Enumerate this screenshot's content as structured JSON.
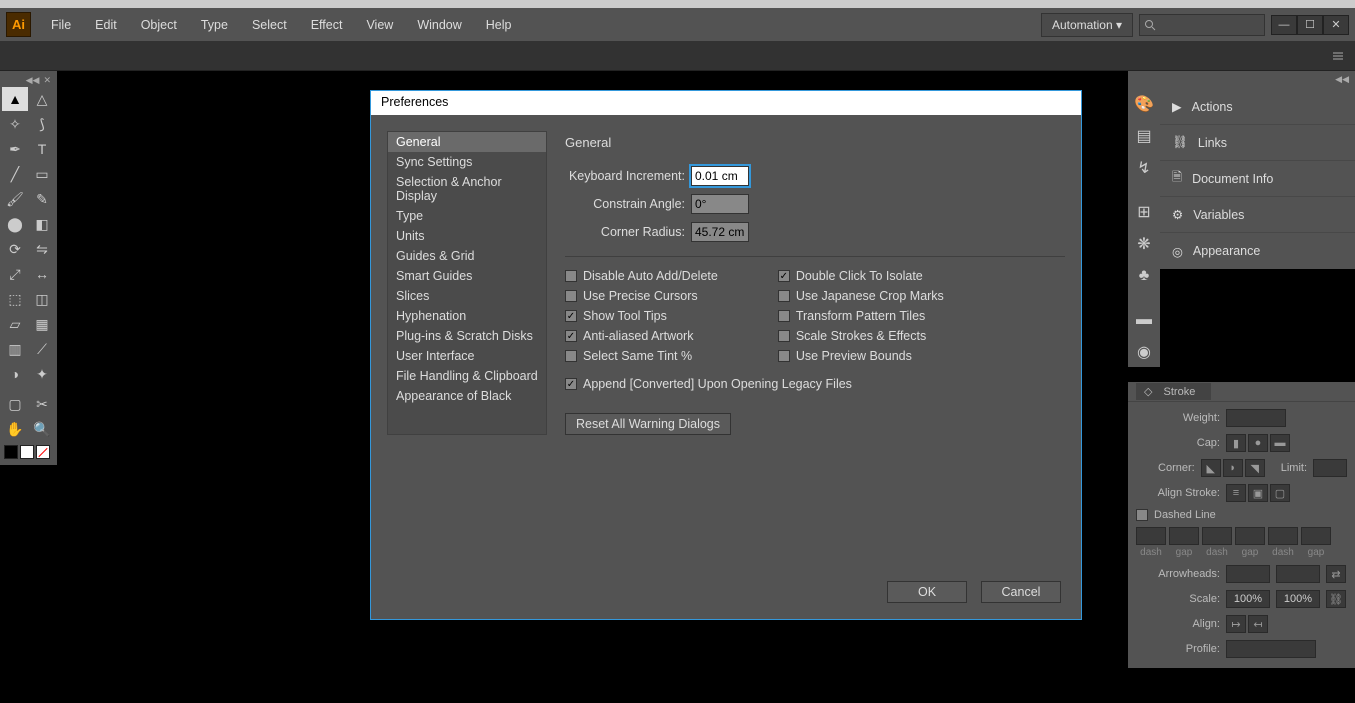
{
  "app": {
    "logo_text": "Ai"
  },
  "menu": {
    "items": [
      "File",
      "Edit",
      "Object",
      "Type",
      "Select",
      "Effect",
      "View",
      "Window",
      "Help"
    ],
    "automation": "Automation  ▾"
  },
  "right_panel": {
    "rows": [
      {
        "icon": "play",
        "label": "Actions"
      },
      {
        "icon": "link",
        "label": "Links"
      },
      {
        "icon": "doc",
        "label": "Document Info"
      },
      {
        "icon": "gear",
        "label": "Variables"
      },
      {
        "icon": "target",
        "label": "Appearance"
      }
    ]
  },
  "stroke": {
    "tab": "Stroke",
    "weight_label": "Weight:",
    "cap_label": "Cap:",
    "corner_label": "Corner:",
    "limit_label": "Limit:",
    "align_label": "Align Stroke:",
    "dashed_label": "Dashed Line",
    "dash_labels": [
      "dash",
      "gap",
      "dash",
      "gap",
      "dash",
      "gap"
    ],
    "arrow_label": "Arrowheads:",
    "scale_label": "Scale:",
    "scale_a": "100%",
    "scale_b": "100%",
    "align2_label": "Align:",
    "profile_label": "Profile:"
  },
  "dialog": {
    "title": "Preferences",
    "side": [
      "General",
      "Sync Settings",
      "Selection & Anchor Display",
      "Type",
      "Units",
      "Guides & Grid",
      "Smart Guides",
      "Slices",
      "Hyphenation",
      "Plug-ins & Scratch Disks",
      "User Interface",
      "File Handling & Clipboard",
      "Appearance of Black"
    ],
    "selected": 0,
    "section": "General",
    "fields": {
      "keyboard_label": "Keyboard Increment:",
      "keyboard_value": "0.01 cm",
      "constrain_label": "Constrain Angle:",
      "constrain_value": "0°",
      "corner_label": "Corner Radius:",
      "corner_value": "45.72 cm"
    },
    "checkboxes_left": [
      {
        "label": "Disable Auto Add/Delete",
        "checked": false
      },
      {
        "label": "Use Precise Cursors",
        "checked": false
      },
      {
        "label": "Show Tool Tips",
        "checked": true
      },
      {
        "label": "Anti-aliased Artwork",
        "checked": true
      },
      {
        "label": "Select Same Tint %",
        "checked": false
      }
    ],
    "checkboxes_right": [
      {
        "label": "Double Click To Isolate",
        "checked": true
      },
      {
        "label": "Use Japanese Crop Marks",
        "checked": false
      },
      {
        "label": "Transform Pattern Tiles",
        "checked": false
      },
      {
        "label": "Scale Strokes & Effects",
        "checked": false
      },
      {
        "label": "Use Preview Bounds",
        "checked": false
      }
    ],
    "append_cb": {
      "label": "Append [Converted] Upon Opening Legacy Files",
      "checked": true
    },
    "reset_btn": "Reset All Warning Dialogs",
    "ok": "OK",
    "cancel": "Cancel"
  }
}
